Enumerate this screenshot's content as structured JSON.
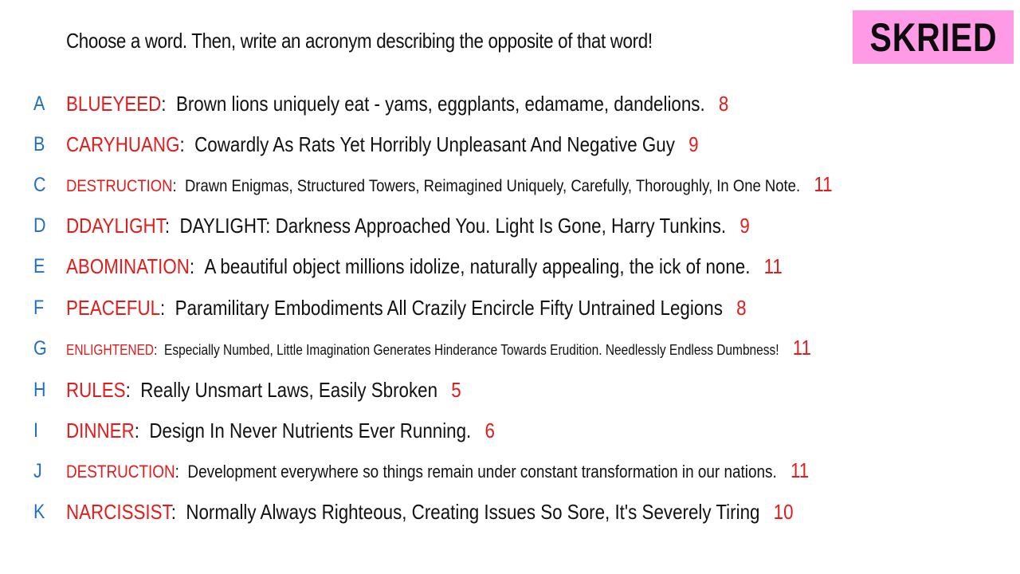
{
  "instruction": "Choose a word. Then, write an acronym describing the opposite of that word!",
  "badge": {
    "text": "SKRIED",
    "background": "#ff9ae6"
  },
  "colors": {
    "word": "#e41b1b",
    "letter": "#1f6fc9",
    "count": "#e41b1b",
    "text": "#111111"
  },
  "entries": [
    {
      "letter": "A",
      "word": "BLUEYEED",
      "phrase": "Brown lions uniquely eat - yams, eggplants, edamame, dandelions.",
      "count": "8"
    },
    {
      "letter": "B",
      "word": "CARYHUANG",
      "phrase": "Cowardly As Rats Yet Horribly Unpleasant And Negative Guy",
      "count": "9"
    },
    {
      "letter": "C",
      "word": "DESTRUCTION",
      "phrase": "Drawn Enigmas, Structured Towers, Reimagined Uniquely, Carefully, Thoroughly, In One Note.",
      "count": "11"
    },
    {
      "letter": "D",
      "word": "DDAYLIGHT",
      "phrase": "DAYLIGHT: Darkness Approached You. Light Is Gone, Harry Tunkins.",
      "count": "9"
    },
    {
      "letter": "E",
      "word": "ABOMINATION",
      "phrase": "A beautiful object millions idolize, naturally appealing, the ick of none.",
      "count": "11"
    },
    {
      "letter": "F",
      "word": "PEACEFUL",
      "phrase": "Paramilitary Embodiments All Crazily Encircle Fifty Untrained Legions",
      "count": "8"
    },
    {
      "letter": "G",
      "word": "ENLIGHTENED",
      "phrase": "Especially Numbed, Little Imagination Generates Hinderance Towards Erudition. Needlessly Endless Dumbness!",
      "count": "11"
    },
    {
      "letter": "H",
      "word": "RULES",
      "phrase": "Really Unsmart Laws, Easily Sbroken",
      "count": "5"
    },
    {
      "letter": "I",
      "word": "DINNER",
      "phrase": "Design In Never Nutrients Ever Running.",
      "count": "6"
    },
    {
      "letter": "J",
      "word": "DESTRUCTION",
      "phrase": "Development everywhere so things remain under constant transformation in our nations.",
      "count": "11"
    },
    {
      "letter": "K",
      "word": "NARCISSIST",
      "phrase": "Normally Always Righteous, Creating Issues So Sore, It's Severely Tiring",
      "count": "10"
    }
  ]
}
